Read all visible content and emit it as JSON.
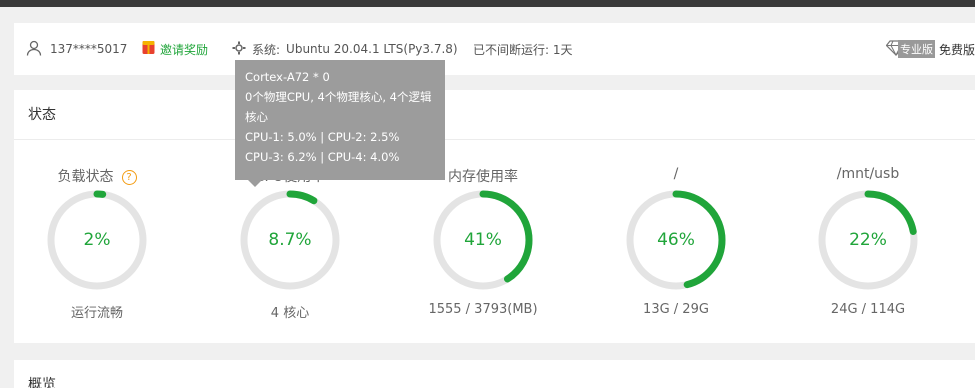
{
  "header": {
    "user": "137****5017",
    "invite": "邀请奖励",
    "system_label": "系统:",
    "system_value": "Ubuntu 20.04.1 LTS(Py3.7.8)",
    "uptime": "已不间断运行: 1天",
    "pro_badge": "专业版",
    "free_label": "免费版"
  },
  "status": {
    "title": "状态",
    "help": "?",
    "gauges": [
      {
        "label": "负载状态",
        "value": "2%",
        "percent": 2,
        "sub": "运行流畅"
      },
      {
        "label": "CPU使用率",
        "value": "8.7%",
        "percent": 8.7,
        "sub": "4 核心"
      },
      {
        "label": "内存使用率",
        "value": "41%",
        "percent": 41,
        "sub": "1555 / 3793(MB)"
      },
      {
        "label": "/",
        "value": "46%",
        "percent": 46,
        "sub": "13G / 29G"
      },
      {
        "label": "/mnt/usb",
        "value": "22%",
        "percent": 22,
        "sub": "24G / 114G"
      }
    ]
  },
  "tooltip": {
    "line1": "Cortex-A72 * 0",
    "line2": "0个物理CPU, 4个物理核心, 4个逻辑核心",
    "line3": "CPU-1: 5.0% | CPU-2: 2.5%",
    "line4": "CPU-3: 6.2% | CPU-4: 4.0%"
  },
  "overview": {
    "title": "概览"
  },
  "colors": {
    "accent": "#20a53a",
    "track": "#e4e4e4",
    "warn": "#f39c12",
    "tooltip_bg": "#9c9c9c"
  },
  "icons": [
    "user-icon",
    "gift-icon",
    "system-gear-icon",
    "diamond-icon",
    "help-icon"
  ]
}
